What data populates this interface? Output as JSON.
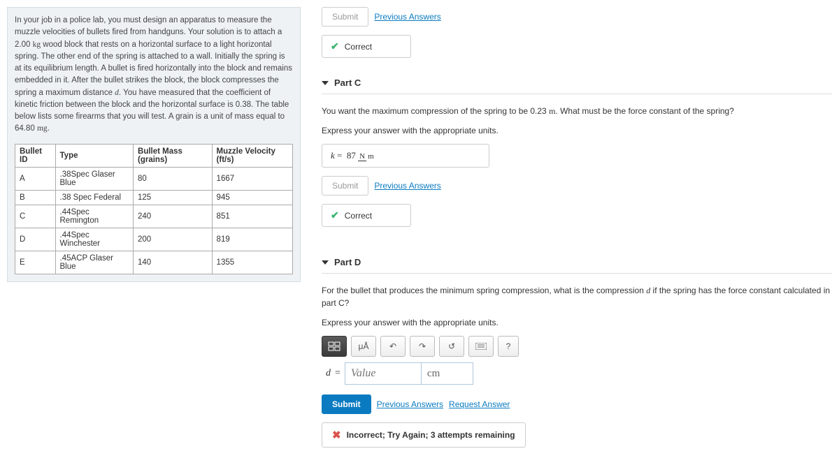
{
  "problem": {
    "text1": "In your job in a police lab, you must design an apparatus to measure the muzzle velocities of bullets fired from handguns. Your solution is to attach a 2.00 ",
    "unit1": "kg",
    "text2": " wood block that rests on a horizontal surface to a light horizontal spring. The other end of the spring is attached to a wall. Initially the spring is at its equilibrium length. A bullet is fired horizontally into the block and remains embedded in it. After the bullet strikes the block, the block compresses the spring a maximum distance ",
    "var_d": "d",
    "text3": ". You have measured that the coefficient of kinetic friction between the block and the horizontal surface is 0.38. The table below lists some firearms that you will test. A grain is a unit of mass equal to 64.80 ",
    "unit2": "mg",
    "text4": "."
  },
  "table": {
    "headers": [
      "Bullet ID",
      "Type",
      "Bullet Mass (grains)",
      "Muzzle Velocity (ft/s)"
    ],
    "rows": [
      [
        "A",
        ".38Spec Glaser Blue",
        "80",
        "1667"
      ],
      [
        "B",
        ".38 Spec Federal",
        "125",
        "945"
      ],
      [
        "C",
        ".44Spec Remington",
        "240",
        "851"
      ],
      [
        "D",
        ".44Spec Winchester",
        "200",
        "819"
      ],
      [
        "E",
        ".45ACP Glaser Blue",
        "140",
        "1355"
      ]
    ]
  },
  "partTop": {
    "submit": "Submit",
    "prev": "Previous Answers",
    "correct": "Correct"
  },
  "partC": {
    "title": "Part C",
    "question": "You want the maximum compression of the spring to be 0.23 ",
    "questionUnit": "m",
    "question2": ". What must be the force constant of the spring?",
    "express": "Express your answer with the appropriate units.",
    "var": "k",
    "eq": "=",
    "value": "87",
    "unitNum": "N",
    "unitDen": "m",
    "submit": "Submit",
    "prev": "Previous Answers",
    "correct": "Correct"
  },
  "partD": {
    "title": "Part D",
    "question1": "For the bullet that produces the minimum spring compression, what is the compression ",
    "var_d": "d",
    "question2": " if the spring has the force constant calculated in part C?",
    "express": "Express your answer with the appropriate units.",
    "micro": "μÅ",
    "help": "?",
    "var": "d",
    "eq": "=",
    "placeholder": "Value",
    "unitValue": "cm",
    "submit": "Submit",
    "prev": "Previous Answers",
    "request": "Request Answer",
    "incorrect": "Incorrect; Try Again; 3 attempts remaining"
  }
}
